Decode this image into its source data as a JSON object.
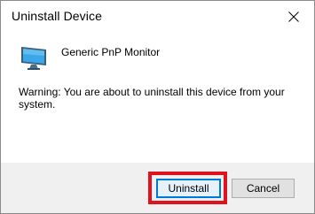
{
  "window": {
    "title": "Uninstall Device",
    "close_icon": "close-icon"
  },
  "device": {
    "icon": "monitor-icon",
    "name": "Generic PnP Monitor"
  },
  "message": {
    "warning": "Warning: You are about to uninstall this device from your system."
  },
  "buttons": {
    "uninstall_label": "Uninstall",
    "cancel_label": "Cancel"
  },
  "colors": {
    "highlight": "#e0121e",
    "accent": "#0078d7",
    "footer_background": "#f0f0f0"
  }
}
